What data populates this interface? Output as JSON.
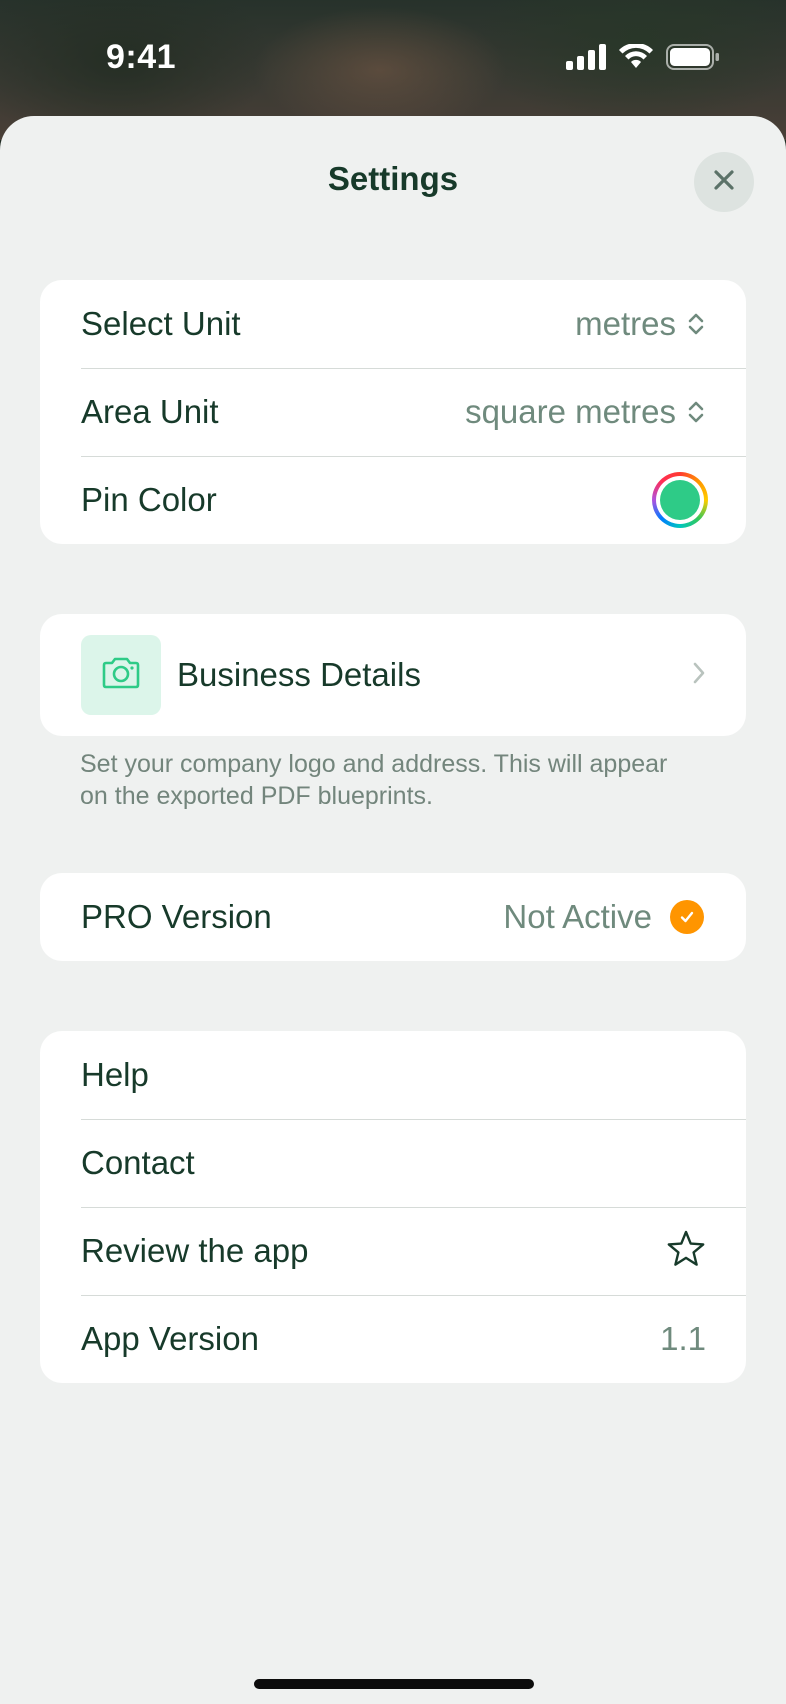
{
  "status_bar": {
    "time": "9:41",
    "icons": [
      "cellular-signal-icon",
      "wifi-icon",
      "battery-icon"
    ]
  },
  "sheet": {
    "title": "Settings",
    "close_icon": "close-icon"
  },
  "units_section": {
    "rows": [
      {
        "label": "Select Unit",
        "value": "metres",
        "icon": "chevron-up-down-icon"
      },
      {
        "label": "Area Unit",
        "value": "square metres",
        "icon": "chevron-up-down-icon"
      },
      {
        "label": "Pin Color",
        "color": "#2ecb87"
      }
    ]
  },
  "business_section": {
    "label": "Business Details",
    "icon": "camera-icon",
    "footnote": "Set your company logo and address. This will appear on the exported PDF blueprints."
  },
  "pro_section": {
    "label": "PRO Version",
    "value": "Not Active",
    "icon": "checkmark-circle-icon",
    "badge_color": "#ff9500"
  },
  "misc_section": {
    "rows": [
      {
        "label": "Help"
      },
      {
        "label": "Contact"
      },
      {
        "label": "Review the app",
        "icon": "star-icon"
      },
      {
        "label": "App Version",
        "value": "1.1"
      }
    ]
  },
  "colors": {
    "sheet_background": "#eff1f0",
    "primary_text": "#173a2a",
    "secondary_text": "#6f8a7d",
    "accent_green": "#2ecb87"
  }
}
